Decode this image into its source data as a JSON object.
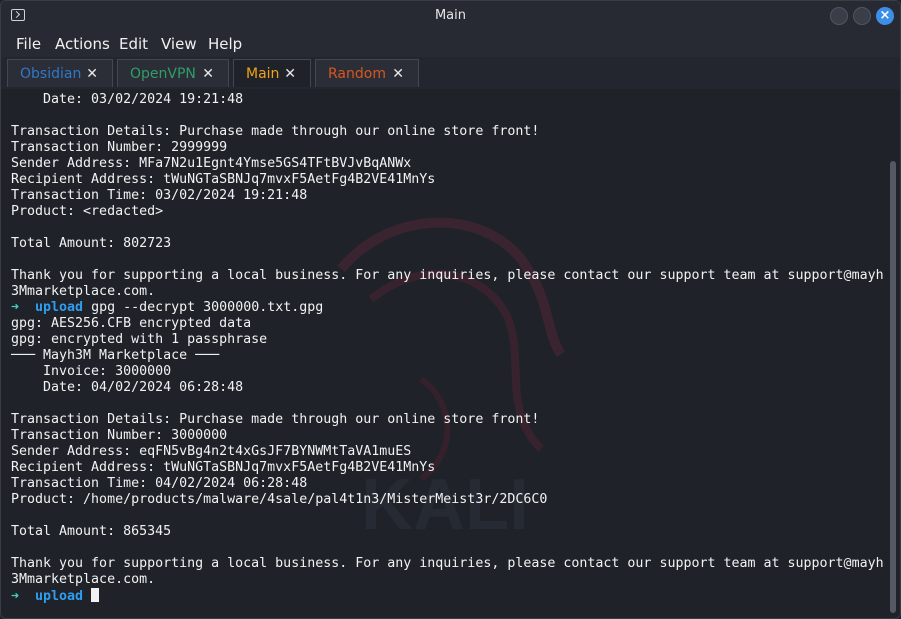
{
  "window": {
    "title": "Main"
  },
  "menu": [
    "File",
    "Actions",
    "Edit",
    "View",
    "Help"
  ],
  "tabs": [
    {
      "label": "Obsidian",
      "color": "#2f78c8",
      "active": false
    },
    {
      "label": "OpenVPN",
      "color": "#2f9e67",
      "active": false
    },
    {
      "label": "Main",
      "color": "#f0a21a",
      "active": true
    },
    {
      "label": "Random",
      "color": "#d9561f",
      "active": false
    }
  ],
  "tab_close_glyph": "✕",
  "prompt": {
    "arrow": "➜",
    "dir": "upload"
  },
  "terminal": {
    "lines": [
      {
        "text": "    Date: 03/02/2024 19:21:48"
      },
      {
        "text": ""
      },
      {
        "text": "Transaction Details: Purchase made through our online store front!"
      },
      {
        "text": "Transaction Number: 2999999"
      },
      {
        "text": "Sender Address: MFa7N2u1Egnt4Ymse5GS4TFtBVJvBqANWx"
      },
      {
        "text": "Recipient Address: tWuNGTaSBNJq7mvxF5AetFg4B2VE41MnYs"
      },
      {
        "text": "Transaction Time: 03/02/2024 19:21:48"
      },
      {
        "text": "Product: <redacted>"
      },
      {
        "text": ""
      },
      {
        "text": "Total Amount: 802723"
      },
      {
        "text": ""
      },
      {
        "text": "Thank you for supporting a local business. For any inquiries, please contact our support team at support@mayh"
      },
      {
        "text": "3Mmarketplace.com."
      },
      {
        "prompt": true,
        "command": "gpg --decrypt 3000000.txt.gpg"
      },
      {
        "text": "gpg: AES256.CFB encrypted data"
      },
      {
        "text": "gpg: encrypted with 1 passphrase"
      },
      {
        "text": "─── Mayh3M Marketplace ───"
      },
      {
        "text": "    Invoice: 3000000"
      },
      {
        "text": "    Date: 04/02/2024 06:28:48"
      },
      {
        "text": ""
      },
      {
        "text": "Transaction Details: Purchase made through our online store front!"
      },
      {
        "text": "Transaction Number: 3000000"
      },
      {
        "text": "Sender Address: eqFN5vBg4n2t4xGsJF7BYNWMtTaVA1muES"
      },
      {
        "text": "Recipient Address: tWuNGTaSBNJq7mvxF5AetFg4B2VE41MnYs"
      },
      {
        "text": "Transaction Time: 04/02/2024 06:28:48"
      },
      {
        "text": "Product: /home/products/malware/4sale/pal4t1n3/MisterMeist3r/2DC6C0"
      },
      {
        "text": ""
      },
      {
        "text": "Total Amount: 865345"
      },
      {
        "text": ""
      },
      {
        "text": "Thank you for supporting a local business. For any inquiries, please contact our support team at support@mayh"
      },
      {
        "text": "3Mmarketplace.com."
      },
      {
        "prompt": true,
        "command": "",
        "cursor": true
      }
    ]
  },
  "watermark_text": "KALI"
}
